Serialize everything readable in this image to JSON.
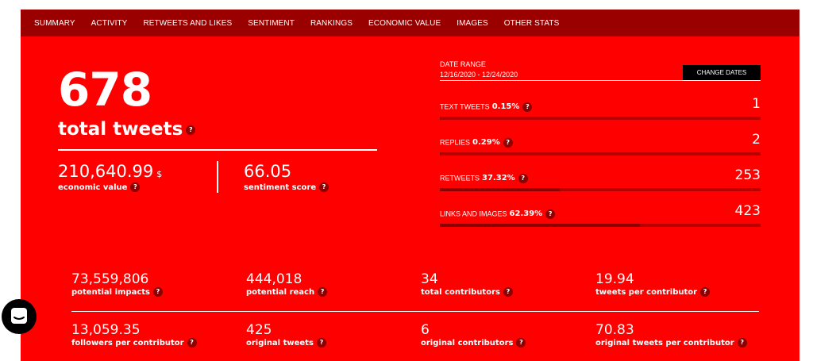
{
  "nav": [
    "SUMMARY",
    "ACTIVITY",
    "RETWEETS AND LIKES",
    "SENTIMENT",
    "RANKINGS",
    "ECONOMIC VALUE",
    "IMAGES",
    "OTHER STATS"
  ],
  "help_glyph": "?",
  "total": {
    "value": "678",
    "label": "total tweets"
  },
  "economic": {
    "value": "210,640.99",
    "unit": "$",
    "label": "economic value"
  },
  "sentiment": {
    "value": "66.05",
    "label": "sentiment score"
  },
  "date_range": {
    "title": "DATE RANGE",
    "value": "12/16/2020 - 12/24/2020",
    "button": "CHANGE DATES"
  },
  "breakdown": [
    {
      "label": "TEXT TWEETS",
      "pct": "0.15%",
      "count": "1",
      "fill": 0.0015
    },
    {
      "label": "REPLIES",
      "pct": "0.29%",
      "count": "2",
      "fill": 0.0029
    },
    {
      "label": "RETWEETS",
      "pct": "37.32%",
      "count": "253",
      "fill": 0.3732
    },
    {
      "label": "LINKS AND IMAGES",
      "pct": "62.39%",
      "count": "423",
      "fill": 0.6239
    }
  ],
  "stats_row1": [
    {
      "value": "73,559,806",
      "label": "potential impacts"
    },
    {
      "value": "444,018",
      "label": "potential reach"
    },
    {
      "value": "34",
      "label": "total contributors"
    },
    {
      "value": "19.94",
      "label": "tweets per contributor"
    }
  ],
  "stats_row2": [
    {
      "value": "13,059.35",
      "label": "followers per contributor"
    },
    {
      "value": "425",
      "label": "original tweets"
    },
    {
      "value": "6",
      "label": "original contributors"
    },
    {
      "value": "70.83",
      "label": "original tweets per contributor"
    }
  ],
  "colors": {
    "panel": "#ff0000",
    "nav": "#9b0000",
    "bar_track": "#b80000",
    "bar_fill": "#8b0000",
    "help_badge": "#8b0000"
  },
  "icons": {
    "help": "question-mark-icon",
    "chat": "chat-bubble-icon"
  }
}
